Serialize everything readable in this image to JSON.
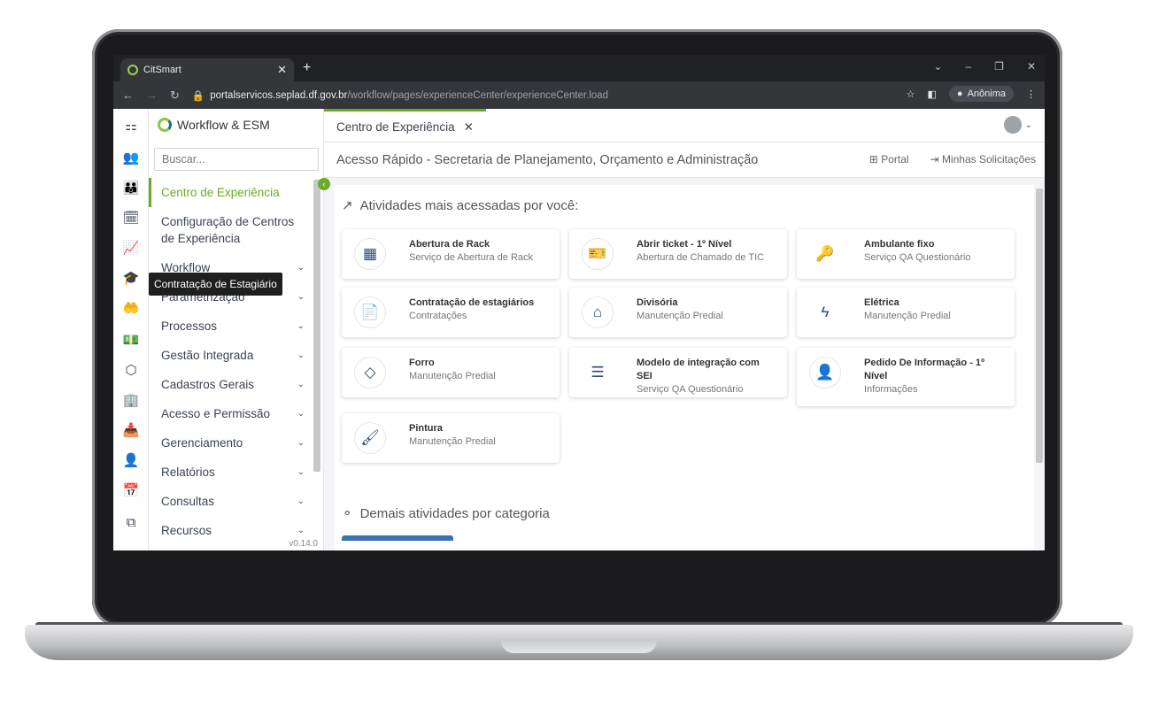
{
  "browser": {
    "tab_title": "CitSmart",
    "url_host": "portalservicos.seplad.df.gov.br",
    "url_path": "/workflow/pages/experienceCenter/experienceCenter.load",
    "profile": "Anônima"
  },
  "sidebar": {
    "brand": "Workflow & ESM",
    "search_placeholder": "Buscar...",
    "items": [
      {
        "label": "Centro de Experiência"
      },
      {
        "label": "Configuração de Centros de Experiência"
      },
      {
        "label": "Workflow"
      },
      {
        "label": "Parametrização"
      },
      {
        "label": "Processos"
      },
      {
        "label": "Gestão Integrada"
      },
      {
        "label": "Cadastros Gerais"
      },
      {
        "label": "Acesso e Permissão"
      },
      {
        "label": "Gerenciamento"
      },
      {
        "label": "Relatórios"
      },
      {
        "label": "Consultas"
      },
      {
        "label": "Recursos"
      }
    ],
    "version": "v0.14.0",
    "tooltip": "Contratação de Estagiário"
  },
  "main": {
    "tab": "Centro de Experiência",
    "title": "Acesso Rápido - Secretaria de Planejamento, Orçamento e Administração",
    "link_portal": "Portal",
    "link_requests": "Minhas Solicitações",
    "section1": "Atividades mais acessadas por você:",
    "section2": "Demais atividades por categoria",
    "cards": [
      {
        "title": "Abertura de Rack",
        "sub": "Serviço de Abertura de Rack"
      },
      {
        "title": "Abrir ticket - 1º Nível",
        "sub": "Abertura de Chamado de TIC"
      },
      {
        "title": "Ambulante fixo",
        "sub": "Serviço QA Questionário"
      },
      {
        "title": "Contratação de estagiários",
        "sub": "Contratações"
      },
      {
        "title": "Divisória",
        "sub": "Manutenção Predial"
      },
      {
        "title": "Elétrica",
        "sub": "Manutenção Predial"
      },
      {
        "title": "Forro",
        "sub": "Manutenção Predial"
      },
      {
        "title": "Modelo de integração com SEI",
        "sub": "Serviço QA Questionário"
      },
      {
        "title": "Pedido De Informação - 1º Nível",
        "sub": "Informações"
      },
      {
        "title": "Pintura",
        "sub": "Manutenção Predial"
      }
    ]
  }
}
